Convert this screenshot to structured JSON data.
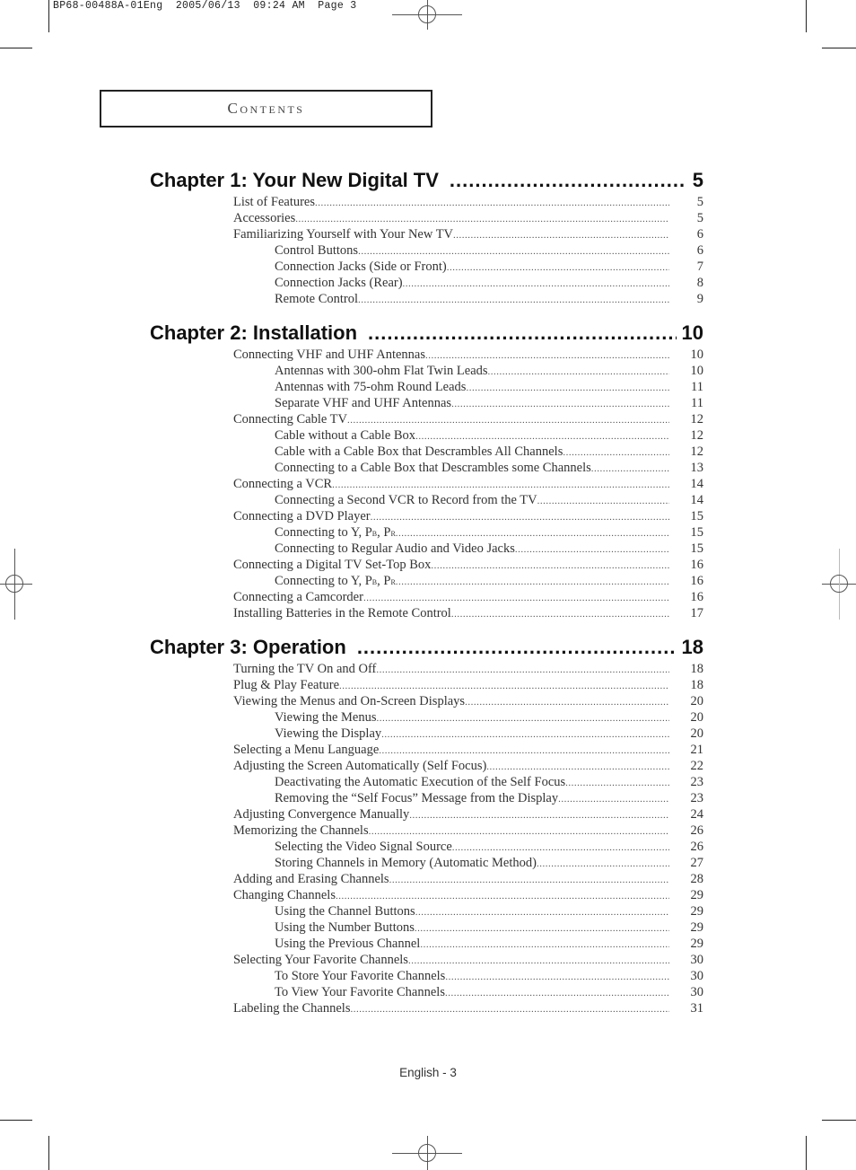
{
  "slug": "BP68-00488A-01Eng  2005/06/13  09:24 AM  Page 3",
  "header_label": "Contents",
  "footer": "English - 3",
  "chapters": [
    {
      "title": "Chapter 1: Your New Digital TV",
      "page": "5",
      "entries": [
        {
          "level": 1,
          "label": "List of Features",
          "page": "5"
        },
        {
          "level": 1,
          "label": "Accessories",
          "page": "5"
        },
        {
          "level": 1,
          "label": "Familiarizing Yourself with Your New TV",
          "page": "6"
        },
        {
          "level": 2,
          "label": "Control Buttons",
          "page": "6"
        },
        {
          "level": 2,
          "label": "Connection Jacks (Side or Front)",
          "page": "7"
        },
        {
          "level": 2,
          "label": "Connection Jacks (Rear)",
          "page": "8"
        },
        {
          "level": 2,
          "label": "Remote Control",
          "page": "9"
        }
      ]
    },
    {
      "title": "Chapter 2: Installation",
      "page": "10",
      "entries": [
        {
          "level": 1,
          "label": "Connecting VHF and UHF Antennas",
          "page": "10"
        },
        {
          "level": 2,
          "label": "Antennas with 300-ohm Flat Twin Leads",
          "page": "10"
        },
        {
          "level": 2,
          "label": "Antennas with 75-ohm Round Leads",
          "page": "11"
        },
        {
          "level": 2,
          "label": "Separate VHF and UHF Antennas",
          "page": "11"
        },
        {
          "level": 1,
          "label": "Connecting Cable TV",
          "page": "12"
        },
        {
          "level": 2,
          "label": "Cable without a Cable Box",
          "page": "12"
        },
        {
          "level": 2,
          "label": "Cable with a Cable Box that Descrambles All Channels",
          "page": "12"
        },
        {
          "level": 2,
          "label": "Connecting to a Cable Box that Descrambles some Channels",
          "page": "13"
        },
        {
          "level": 1,
          "label": "Connecting a VCR",
          "page": "14"
        },
        {
          "level": 2,
          "label": "Connecting a Second VCR to Record from the TV",
          "page": "14"
        },
        {
          "level": 1,
          "label": "Connecting a DVD Player",
          "page": "15"
        },
        {
          "level": 2,
          "label": "Connecting to Y, PB, PR",
          "page": "15"
        },
        {
          "level": 2,
          "label": "Connecting to Regular Audio and Video Jacks",
          "page": "15"
        },
        {
          "level": 1,
          "label": "Connecting a Digital TV Set-Top Box",
          "page": "16"
        },
        {
          "level": 2,
          "label": "Connecting to Y, PB, PR",
          "page": "16"
        },
        {
          "level": 1,
          "label": "Connecting a Camcorder",
          "page": "16"
        },
        {
          "level": 1,
          "label": "Installing Batteries in the Remote Control",
          "page": "17"
        }
      ]
    },
    {
      "title": "Chapter 3: Operation",
      "page": "18",
      "entries": [
        {
          "level": 1,
          "label": "Turning the TV On and Off",
          "page": "18"
        },
        {
          "level": 1,
          "label": "Plug & Play Feature",
          "page": "18"
        },
        {
          "level": 1,
          "label": "Viewing the Menus and On-Screen Displays",
          "page": "20"
        },
        {
          "level": 2,
          "label": "Viewing the Menus",
          "page": "20"
        },
        {
          "level": 2,
          "label": "Viewing the Display",
          "page": "20"
        },
        {
          "level": 1,
          "label": "Selecting a Menu Language",
          "page": "21"
        },
        {
          "level": 1,
          "label": "Adjusting the Screen Automatically (Self Focus)",
          "page": "22"
        },
        {
          "level": 2,
          "label": "Deactivating the Automatic Execution of the Self Focus",
          "page": "23"
        },
        {
          "level": 2,
          "label": "Removing the “Self Focus” Message from the Display",
          "page": "23"
        },
        {
          "level": 1,
          "label": "Adjusting Convergence Manually",
          "page": "24"
        },
        {
          "level": 1,
          "label": "Memorizing the Channels",
          "page": "26"
        },
        {
          "level": 2,
          "label": "Selecting the Video Signal Source",
          "page": "26"
        },
        {
          "level": 2,
          "label": "Storing Channels in Memory (Automatic Method)",
          "page": "27"
        },
        {
          "level": 1,
          "label": "Adding and Erasing Channels",
          "page": "28"
        },
        {
          "level": 1,
          "label": "Changing Channels",
          "page": "29"
        },
        {
          "level": 2,
          "label": "Using the Channel Buttons",
          "page": "29"
        },
        {
          "level": 2,
          "label": "Using the Number Buttons",
          "page": "29"
        },
        {
          "level": 2,
          "label": "Using the Previous Channel",
          "page": "29"
        },
        {
          "level": 1,
          "label": "Selecting Your Favorite Channels",
          "page": "30"
        },
        {
          "level": 2,
          "label": "To Store Your Favorite Channels",
          "page": "30"
        },
        {
          "level": 2,
          "label": "To View Your Favorite Channels",
          "page": "30"
        },
        {
          "level": 1,
          "label": "Labeling the Channels",
          "page": "31"
        }
      ]
    }
  ]
}
